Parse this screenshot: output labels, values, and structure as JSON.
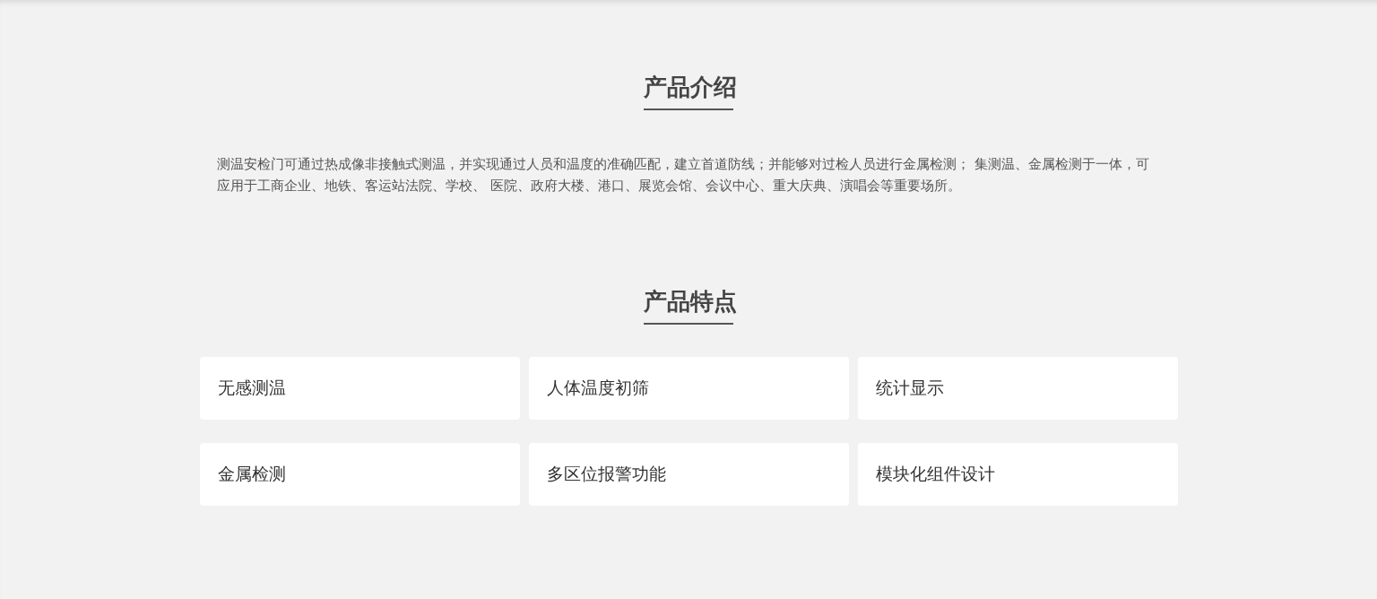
{
  "sections": [
    {
      "title": "产品介绍",
      "paragraph": "测温安检门可通过热成像非接触式测温，并实现通过人员和温度的准确匹配，建立首道防线；并能够对过检人员进行金属检测； 集测温、金属检测于一体，可应用于工商企业、地铁、客运站法院、学校、 医院、政府大楼、港口、展览会馆、会议中心、重大庆典、演唱会等重要场所。"
    },
    {
      "title": "产品特点",
      "features": [
        "无感测温",
        "人体温度初筛",
        "统计显示",
        "金属检测",
        "多区位报警功能",
        "模块化组件设计"
      ]
    }
  ]
}
